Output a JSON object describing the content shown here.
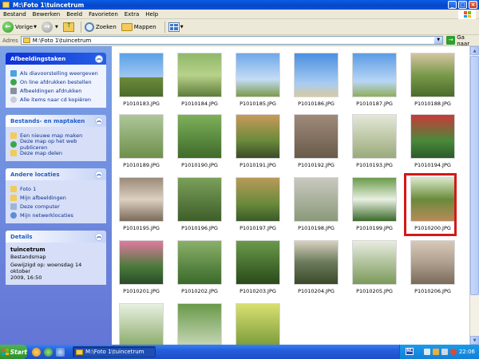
{
  "window": {
    "title": "M:\\Foto 1\\tuincetrum",
    "minimize": "_",
    "maximize": "□",
    "close": "×"
  },
  "menu": [
    "Bestand",
    "Bewerken",
    "Beeld",
    "Favorieten",
    "Extra",
    "Help"
  ],
  "toolbar": {
    "back": "Vorige",
    "search": "Zoeken",
    "folders": "Mappen"
  },
  "address": {
    "label": "Adres",
    "value": "M:\\Foto 1\\tuincetrum",
    "go": "Ga naar"
  },
  "tasks": {
    "title": "Afbeeldingstaken",
    "items": [
      "Als diavoorstelling weergeven",
      "On line afdrukken bestellen",
      "Afbeeldingen afdrukken",
      "Alle items naar cd kopiëren"
    ]
  },
  "filetasks": {
    "title": "Bestands- en maptaken",
    "items": [
      "Een nieuwe map maken",
      "Deze map op het web publiceren",
      "Deze map delen"
    ]
  },
  "places": {
    "title": "Andere locaties",
    "items": [
      "Foto 1",
      "Mijn afbeeldingen",
      "Deze computer",
      "Mijn netwerklocaties"
    ]
  },
  "details": {
    "title": "Details",
    "name": "tuincetrum",
    "type": "Bestandsmap",
    "modified_line1": "Gewijzigd op: woensdag 14 oktober",
    "modified_line2": "2009, 16:50"
  },
  "files": [
    "P1010183.JPG",
    "P1010184.JPG",
    "P1010185.JPG",
    "P1010186.JPG",
    "P1010187.JPG",
    "P1010188.JPG",
    "P1010189.JPG",
    "P1010190.JPG",
    "P1010191.JPG",
    "P1010192.JPG",
    "P1010193.JPG",
    "P1010194.JPG",
    "P1010195.JPG",
    "P1010196.JPG",
    "P1010197.JPG",
    "P1010198.JPG",
    "P1010199.JPG",
    "P1010200.JPG",
    "P1010201.JPG",
    "P1010202.JPG",
    "P1010203.JPG",
    "P1010204.JPG",
    "P1010205.JPG",
    "P1010206.JPG"
  ],
  "taskbar": {
    "start": "Start",
    "item": "M:\\Foto 1\\tuincetrum",
    "lang": "NL",
    "clock": "22:06"
  }
}
